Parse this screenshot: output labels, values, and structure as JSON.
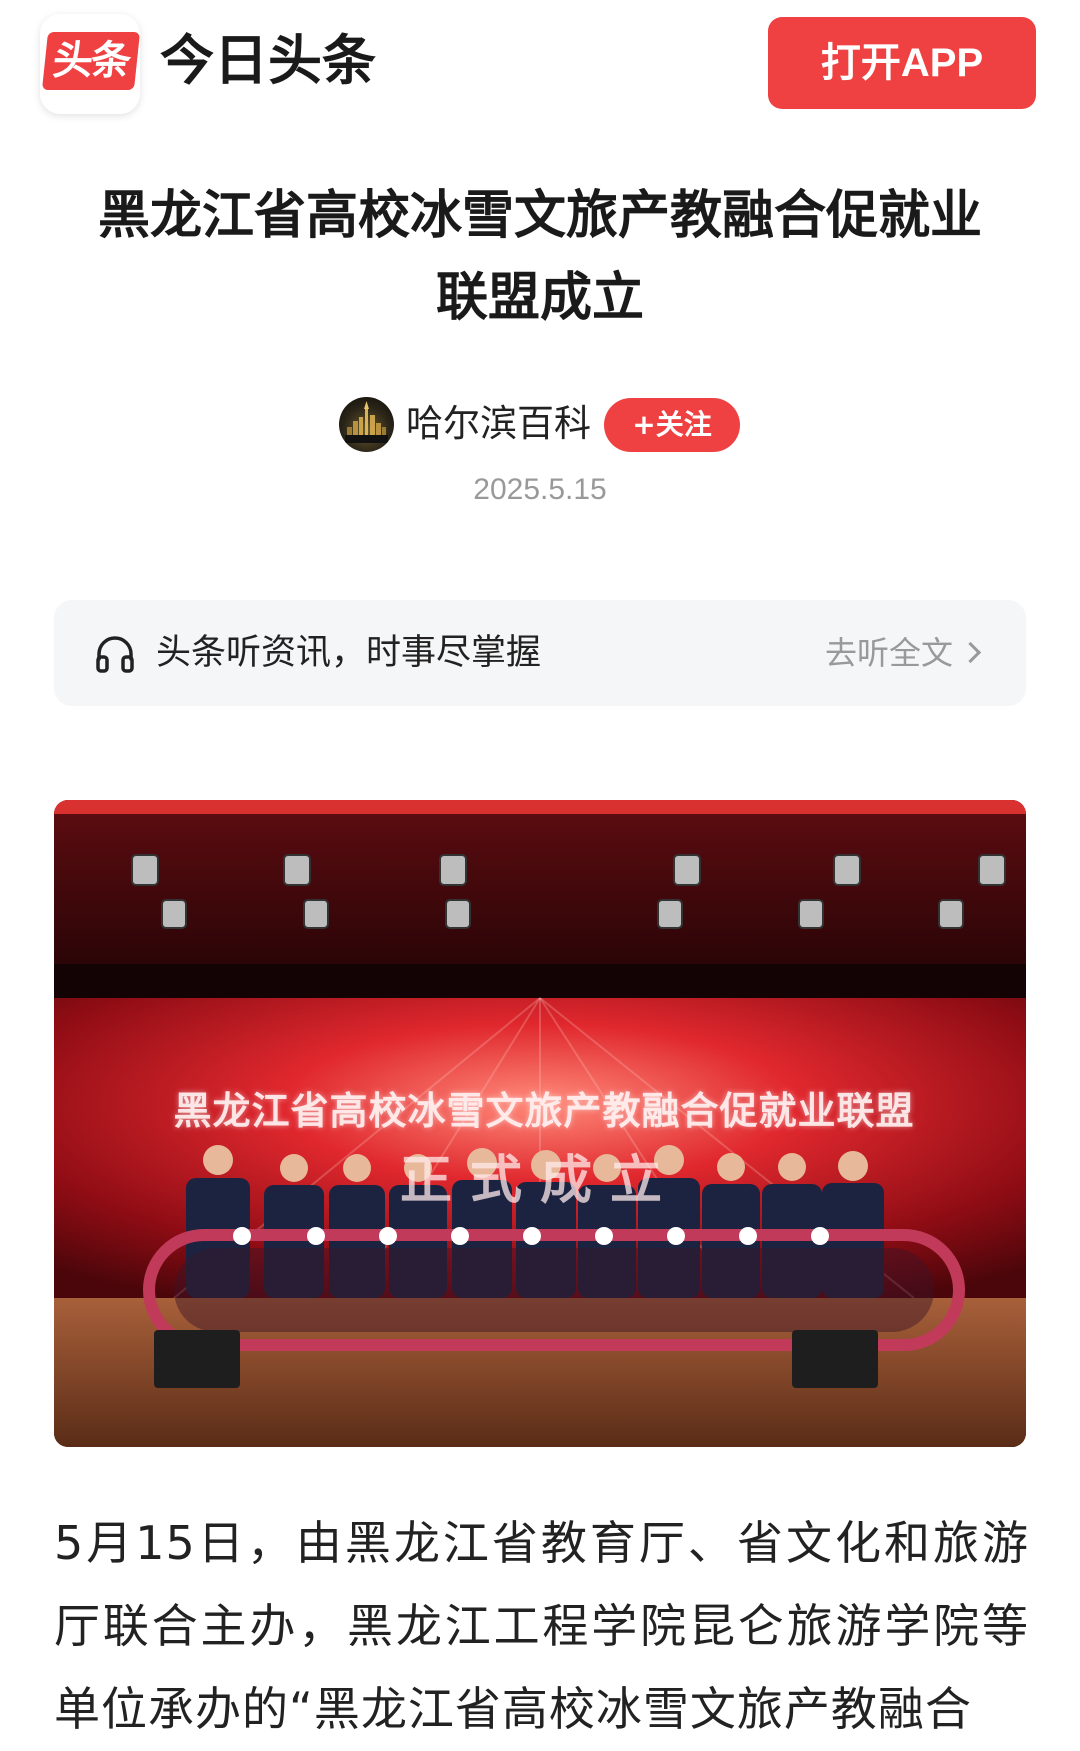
{
  "header": {
    "logo_text": "头条",
    "app_name": "今日头条",
    "open_app_label": "打开APP"
  },
  "article": {
    "title": "黑龙江省高校冰雪文旅产教融合促就业联盟成立",
    "author": {
      "name": "哈尔滨百科",
      "avatar_text": "哈尔滨百科",
      "follow_label": "+关注"
    },
    "date": "2025.5.15",
    "listen_bar": {
      "icon": "headphone-icon",
      "text": "头条听资讯，时事尽掌握",
      "link_label": "去听全文"
    },
    "photo": {
      "banner_title": "黑龙江省高校冰雪文旅产教融合促就业联盟",
      "banner_sub": "正式成立"
    },
    "body": "5月15日，由黑龙江省教育厅、省文化和旅游厅联合主办，黑龙江工程学院昆仑旅游学院等单位承办的“黑龙江省高校冰雪文旅产教融合"
  },
  "colors": {
    "accent": "#f04142",
    "muted_text": "#999999",
    "listen_bar_bg": "#f5f6f7"
  }
}
